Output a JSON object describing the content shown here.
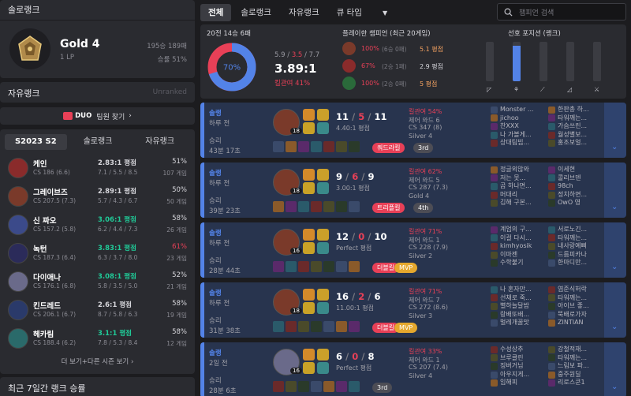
{
  "left": {
    "solo_title": "솔로랭크",
    "tier": "Gold 4",
    "lp": "1 LP",
    "record": "195승 189패",
    "winrate": "승률 51%",
    "flex_title": "자유랭크",
    "flex_status": "Unranked",
    "duo_label": "DUO",
    "duo_text": "팀원 찾기",
    "season_tabs": [
      "S2023 S2",
      "솔로랭크",
      "자유랭크"
    ],
    "champions": [
      {
        "name": "케인",
        "cs": "CS 186 (6.6)",
        "kda": "2.83:1 평점",
        "kda_color": "#d6d6db",
        "kda_detail": "7.1 / 5.5 / 8.5",
        "wr": "51%",
        "wr_color": "#d6d6db",
        "games": "107 게임",
        "color": "#8a2b2b"
      },
      {
        "name": "그레이브즈",
        "cs": "CS 207.5 (7.3)",
        "kda": "2.89:1 평점",
        "kda_color": "#d6d6db",
        "kda_detail": "5.7 / 4.3 / 6.7",
        "wr": "50%",
        "wr_color": "#d6d6db",
        "games": "50 게임",
        "color": "#7a3a2a"
      },
      {
        "name": "신 짜오",
        "cs": "CS 157.2 (5.8)",
        "kda": "3.06:1 평점",
        "kda_color": "#20c997",
        "kda_detail": "6.2 / 4.4 / 7.3",
        "wr": "58%",
        "wr_color": "#d6d6db",
        "games": "26 게임",
        "color": "#3b4a8a"
      },
      {
        "name": "녹턴",
        "cs": "CS 187.3 (6.4)",
        "kda": "3.83:1 평점",
        "kda_color": "#20c997",
        "kda_detail": "6.3 / 3.7 / 8.0",
        "wr": "61%",
        "wr_color": "#e84057",
        "games": "23 게임",
        "color": "#2b2b5a"
      },
      {
        "name": "다이애나",
        "cs": "CS 176.1 (6.8)",
        "kda": "3.08:1 평점",
        "kda_color": "#20c997",
        "kda_detail": "5.8 / 3.5 / 5.0",
        "wr": "52%",
        "wr_color": "#d6d6db",
        "games": "21 게임",
        "color": "#6a6a8a"
      },
      {
        "name": "킨드레드",
        "cs": "CS 206.1 (6.7)",
        "kda": "2.6:1 평점",
        "kda_color": "#d6d6db",
        "kda_detail": "8.7 / 5.8 / 6.3",
        "wr": "58%",
        "wr_color": "#d6d6db",
        "games": "19 게임",
        "color": "#2a3a6a"
      },
      {
        "name": "헤카림",
        "cs": "CS 188.4 (6.2)",
        "kda": "3.1:1 평점",
        "kda_color": "#20c997",
        "kda_detail": "7.8 / 5.3 / 8.4",
        "wr": "58%",
        "wr_color": "#d6d6db",
        "games": "12 게임",
        "color": "#2a6a6a"
      }
    ],
    "more_seasons": "더 보기+다른 시즌 보기",
    "recent7": "최근 7일간 랭크 승률"
  },
  "tabs": [
    "전체",
    "솔로랭크",
    "자유랭크",
    "큐 타입"
  ],
  "search_placeholder": "챔피언 검색",
  "summary": {
    "games": "20전 14승 6패",
    "donut_pct": "70%",
    "win_fraction": 0.7,
    "kda_parts": [
      "5.9",
      "3.5",
      "7.7"
    ],
    "kda_ratio": "3.89:1",
    "kill_part": "킬관여 41%",
    "played_title": "플레이한 챔피언 (최근 20게임)",
    "played": [
      {
        "wr": "100%",
        "rec": "(6승 0패)",
        "kda": "5.1 평점",
        "kda_color": "#f4a261",
        "color": "#7a3a2a"
      },
      {
        "wr": "67%",
        "rec": "(2승 1패)",
        "kda": "2.9 평점",
        "kda_color": "#d6d6db",
        "color": "#8a2b2b"
      },
      {
        "wr": "100%",
        "rec": "(2승 0패)",
        "kda": "5 평점",
        "kda_color": "#f4a261",
        "color": "#2a6a3a"
      }
    ],
    "pos_title": "선호 포지션 (랭크)",
    "positions": [
      0.0,
      0.9,
      0.0,
      0.0,
      0.0
    ]
  },
  "games": [
    {
      "queue": "솔랭",
      "ago": "하루 전",
      "result": "승리",
      "duration": "43분 17초",
      "level": "18",
      "k": "11",
      "d": "5",
      "a": "11",
      "kda": "4.40:1 평점",
      "kp": "킬관여 54%",
      "ward": "제어 와드 6",
      "cs": "CS 347 (8)",
      "tier": "Silver 4",
      "badges": [
        {
          "t": "쿼드라킬",
          "c": "#e84057"
        },
        {
          "t": "3rd",
          "c": "#4d4d55"
        }
      ],
      "team1": [
        "Monster ...",
        "jichoo",
        "찬XXX",
        "나 가볼게...",
        "상대팀빕..."
      ],
      "team2": [
        "한판총 하...",
        "타워깨는...",
        "가슴쓰린...",
        "월성별보...",
        "홍조보얼..."
      ],
      "color": "#7a3a2a"
    },
    {
      "queue": "솔랭",
      "ago": "하루 전",
      "result": "승리",
      "duration": "39분 23초",
      "level": "18",
      "k": "9",
      "d": "6",
      "a": "9",
      "kda": "3.00:1 평점",
      "kp": "킬관여 62%",
      "ward": "제어 와드 5",
      "cs": "CS 287 (7.3)",
      "tier": "Gold 4",
      "badges": [
        {
          "t": "트리플킬",
          "c": "#e84057"
        },
        {
          "t": "4th",
          "c": "#4d4d55"
        }
      ],
      "team1": [
        "정글외않와",
        "저는 못...",
        "곰 하나면...",
        "머대리",
        "김해 구본..."
      ],
      "team2": [
        "이세현",
        "콜리브덴",
        "98ch",
        "정치하면...",
        "OwO 영"
      ],
      "color": "#7a3a2a"
    },
    {
      "queue": "솔랭",
      "ago": "하루 전",
      "result": "승리",
      "duration": "28분 44초",
      "level": "16",
      "k": "12",
      "d": "0",
      "a": "10",
      "kda": "Perfect 평점",
      "kp": "킬관여 71%",
      "ward": "제어 와드 1",
      "cs": "CS 228 (7.9)",
      "tier": "Silver 2",
      "badges": [
        {
          "t": "더블킬",
          "c": "#e84057"
        },
        {
          "t": "MVP",
          "c": "#e5a82e"
        }
      ],
      "team1": [
        "계엄의 구...",
        "이걸 다시...",
        "kimhyosik",
        "이마젠",
        "수학불기"
      ],
      "team2": [
        "서로노긴...",
        "타워깨는...",
        "내사랑예삐",
        "드름피카나",
        "한마디만..."
      ],
      "color": "#7a3a2a"
    },
    {
      "queue": "솔랭",
      "ago": "하루 전",
      "result": "승리",
      "duration": "31분 38초",
      "level": "18",
      "k": "16",
      "d": "2",
      "a": "6",
      "kda": "11.00:1 평점",
      "kp": "킬관여 71%",
      "ward": "제어 와드 7",
      "cs": "CS 272 (8.6)",
      "tier": "Silver 3",
      "badges": [
        {
          "t": "더블킬",
          "c": "#e84057"
        },
        {
          "t": "MVP",
          "c": "#e5a82e"
        }
      ],
      "team1": [
        "나 혼자만...",
        "선채로 죽...",
        "별하늘달밤",
        "랑배또배...",
        "벌레개꿀맛"
      ],
      "team2": [
        "염준식허락",
        "타워깨는...",
        "아이브 좋...",
        "뚝배로가자",
        "ZINTIAN"
      ],
      "color": "#7a3a2a"
    },
    {
      "queue": "솔랭",
      "ago": "2일 전",
      "result": "승리",
      "duration": "28분 6초",
      "level": "16",
      "k": "6",
      "d": "0",
      "a": "8",
      "kda": "Perfect 평점",
      "kp": "킬관여 33%",
      "ward": "제어 와드 1",
      "cs": "CS 207 (7.4)",
      "tier": "Silver 4",
      "badges": [
        {
          "t": "3rd",
          "c": "#4d4d55"
        }
      ],
      "team1": [
        "수성상추",
        "브루클린",
        "징버거님",
        "아우지게...",
        "임해피"
      ],
      "team2": [
        "강철적재...",
        "타워깨는...",
        "느림보 파...",
        "중주원딜",
        "리로스쿤1"
      ],
      "color": "#6a6a8a"
    }
  ]
}
